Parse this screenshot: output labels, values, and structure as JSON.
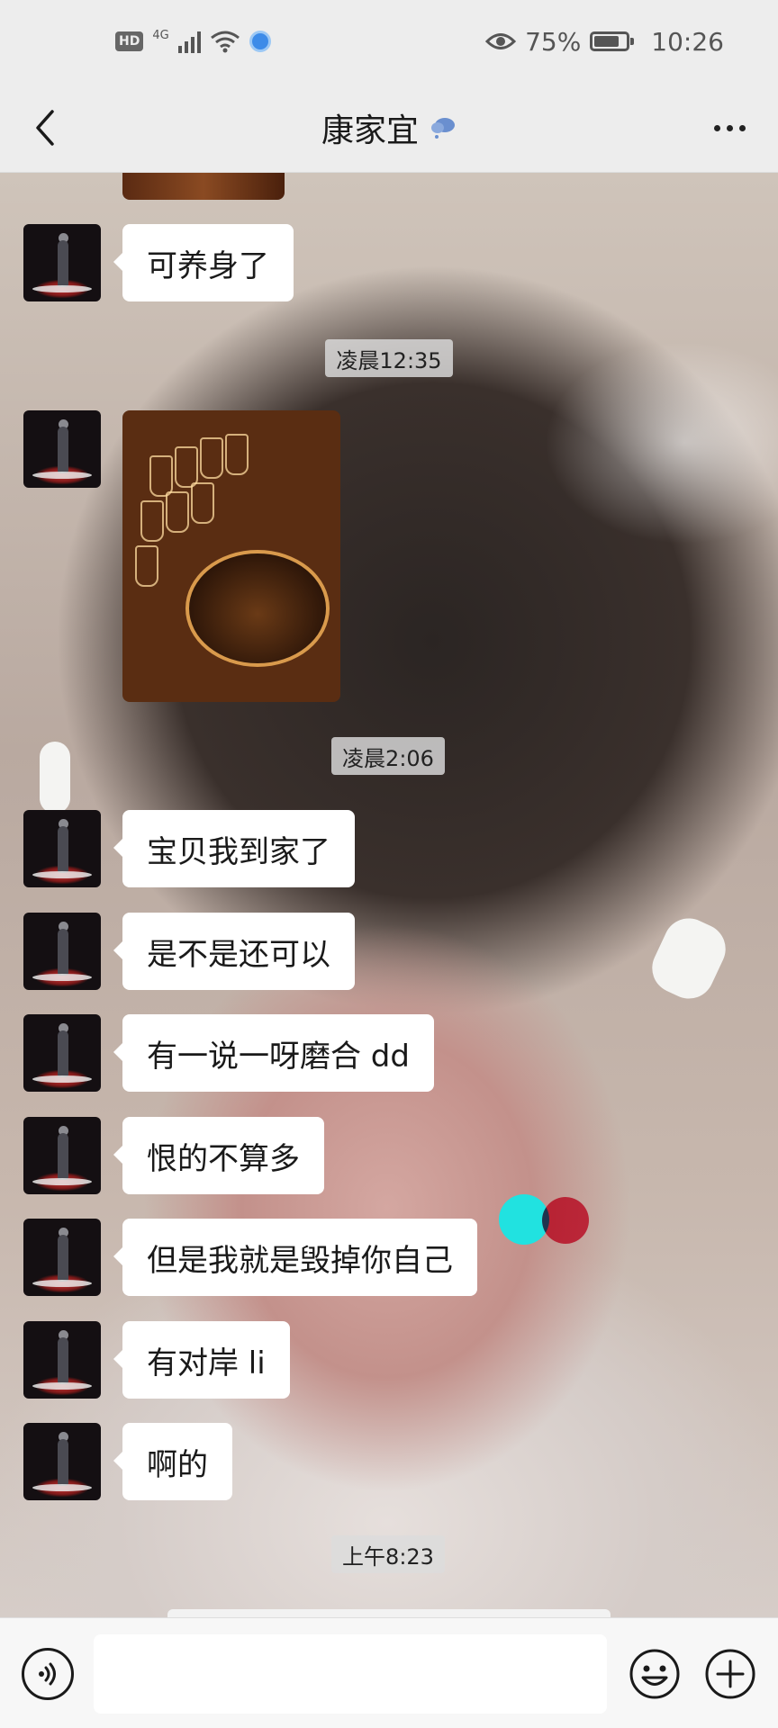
{
  "status_bar": {
    "hd": "HD",
    "network": "4G",
    "battery_percent": "75%",
    "battery_level": 0.75,
    "time": "10:26"
  },
  "header": {
    "contact_name": "康家宜",
    "icons": [
      "back-arrow-icon",
      "weather-icon",
      "more-icon"
    ]
  },
  "messages": [
    {
      "type": "text",
      "text": "可养身了"
    },
    {
      "type": "time",
      "text": "凌晨12:35"
    },
    {
      "type": "image",
      "alt": "photo"
    },
    {
      "type": "time",
      "text": "凌晨2:06"
    },
    {
      "type": "text",
      "text": "宝贝我到家了"
    },
    {
      "type": "text",
      "text": "是不是还可以"
    },
    {
      "type": "text",
      "text": "有一说一呀磨合 dd"
    },
    {
      "type": "text",
      "text": "恨的不算多"
    },
    {
      "type": "text",
      "text": "但是我就是毁掉你自己"
    },
    {
      "type": "text",
      "text": "有对岸 li"
    },
    {
      "type": "text",
      "text": "啊的"
    },
    {
      "type": "time",
      "text": "上午8:23"
    }
  ],
  "input_bar": {
    "placeholder": "",
    "icons": [
      "voice-icon",
      "emoji-icon",
      "plus-icon"
    ]
  },
  "colors": {
    "bubble": "#ffffff",
    "bar_bg": "#ededed",
    "loc_dot": "#3d8be8"
  }
}
